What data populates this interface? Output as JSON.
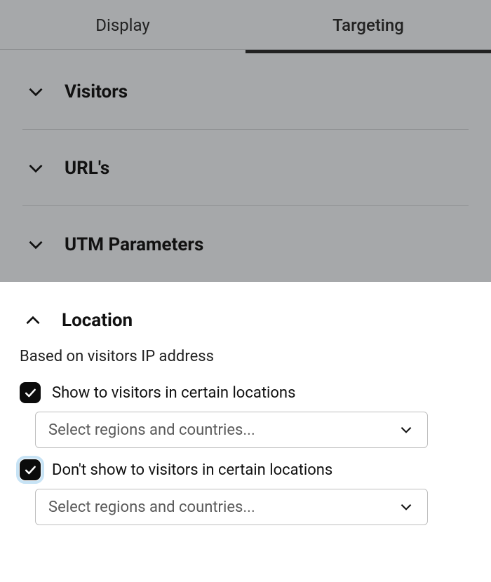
{
  "tabs": {
    "display": "Display",
    "targeting": "Targeting"
  },
  "accordions": {
    "visitors": "Visitors",
    "urls": "URL's",
    "utm": "UTM Parameters",
    "location": "Location"
  },
  "location": {
    "subtext": "Based on visitors IP address",
    "show": {
      "label": "Show to visitors in certain locations",
      "placeholder": "Select regions and countries..."
    },
    "hide": {
      "label": "Don't show to visitors in certain locations",
      "placeholder": "Select regions and countries..."
    }
  }
}
